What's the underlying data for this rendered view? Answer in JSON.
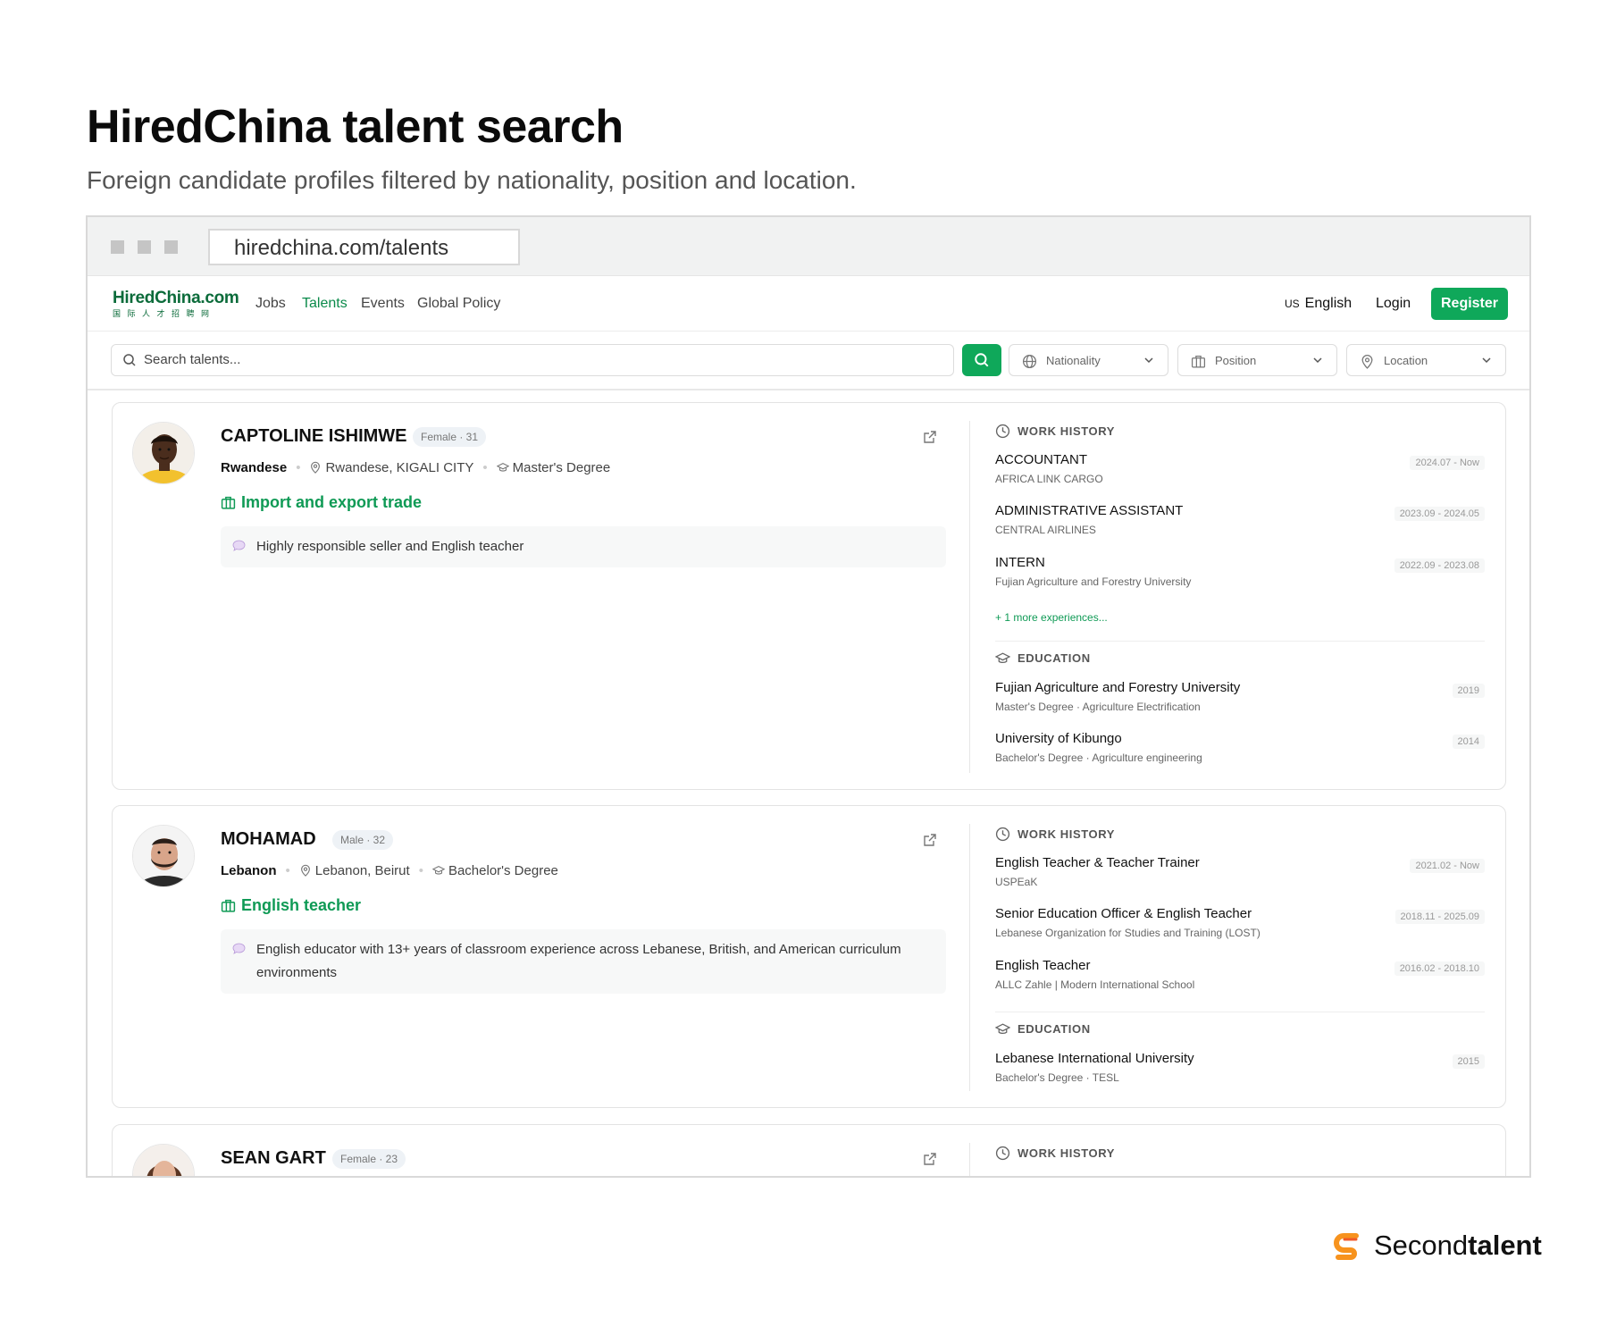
{
  "hero": {
    "title": "HiredChina talent search",
    "subtitle": "Foreign candidate profiles filtered by nationality, position and location."
  },
  "browser": {
    "url": "hiredchina.com/talents"
  },
  "nav": {
    "logo": "HiredChina.com",
    "logo_cn": "国际人才招聘网",
    "links": [
      "Jobs",
      "Talents",
      "Events",
      "Global Policy"
    ],
    "active": "Talents",
    "lang_flag": "US",
    "lang": "English",
    "login": "Login",
    "register": "Register"
  },
  "filters": {
    "search_placeholder": "Search talents...",
    "nationality": "Nationality",
    "position": "Position",
    "location": "Location"
  },
  "section_labels": {
    "work": "WORK HISTORY",
    "education": "EDUCATION"
  },
  "candidates": [
    {
      "name": "CAPTOLINE ISHIMWE",
      "badge": "Female · 31",
      "nationality": "Rwandese",
      "location": "Rwandese, KIGALI CITY",
      "degree": "Master's Degree",
      "position": "Import and export trade",
      "summary": "Highly responsible seller and English teacher",
      "work": [
        {
          "title": "ACCOUNTANT",
          "org": "AFRICA LINK CARGO",
          "dates": "2024.07 - Now"
        },
        {
          "title": "ADMINISTRATIVE ASSISTANT",
          "org": "CENTRAL AIRLINES",
          "dates": "2023.09 - 2024.05"
        },
        {
          "title": "INTERN",
          "org": "Fujian Agriculture and Forestry University",
          "dates": "2022.09 - 2023.08"
        }
      ],
      "more": "+ 1 more experiences...",
      "education": [
        {
          "school": "Fujian Agriculture and Forestry University",
          "detail": "Master's Degree · Agriculture Electrification",
          "year": "2019"
        },
        {
          "school": "University of Kibungo",
          "detail": "Bachelor's Degree · Agriculture engineering",
          "year": "2014"
        }
      ]
    },
    {
      "name": "MOHAMAD",
      "badge": "Male · 32",
      "nationality": "Lebanon",
      "location": "Lebanon, Beirut",
      "degree": "Bachelor's Degree",
      "position": "English teacher",
      "summary": "English educator with 13+ years of classroom experience across Lebanese, British, and American curriculum environments",
      "work": [
        {
          "title": "English Teacher & Teacher Trainer",
          "org": "USPEaK",
          "dates": "2021.02 - Now"
        },
        {
          "title": "Senior Education Officer & English Teacher",
          "org": "Lebanese Organization for Studies and Training (LOST)",
          "dates": "2018.11 - 2025.09"
        },
        {
          "title": "English Teacher",
          "org": "ALLC Zahle | Modern International School",
          "dates": "2016.02 - 2018.10"
        }
      ],
      "education": [
        {
          "school": "Lebanese International University",
          "detail": "Bachelor's Degree · TESL",
          "year": "2015"
        }
      ]
    },
    {
      "name": "SEAN GART",
      "badge": "Female · 23"
    }
  ],
  "footer_brand": {
    "prefix": "Second",
    "suffix": "talent"
  },
  "colors": {
    "accent": "#0fa85a",
    "brand_orange": "#f7931e"
  }
}
